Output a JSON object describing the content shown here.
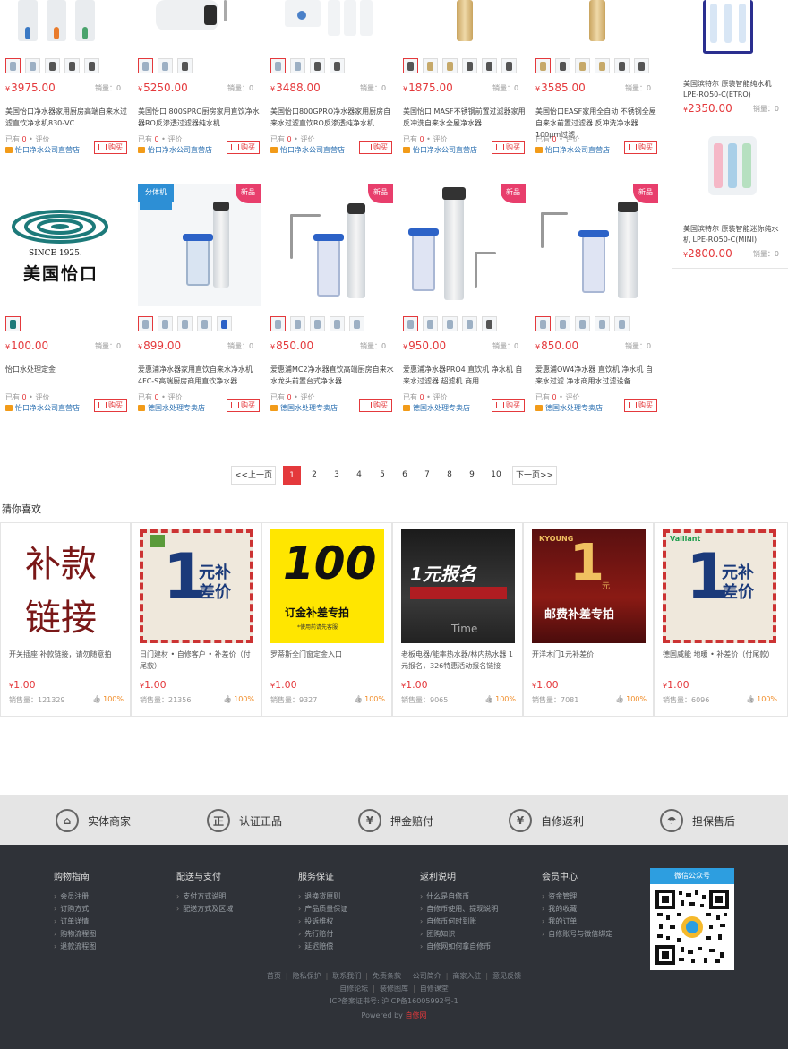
{
  "products_row1": [
    {
      "price": "3975.00",
      "sales": "销量：0",
      "name": "美国怡口净水器家用厨房高端自来水过滤直饮净水机830-VC",
      "reviews_prefix": "已有",
      "reviews_count": "0",
      "reviews_suffix": "评价",
      "shop": "怡口净水公司直营店",
      "buy": "购买"
    },
    {
      "price": "5250.00",
      "sales": "销量：0",
      "name": "美国怡口 800SPRO厨房家用直饮净水器RO反渗透过滤器纯水机",
      "reviews_prefix": "已有",
      "reviews_count": "0",
      "reviews_suffix": "评价",
      "shop": "怡口净水公司直营店",
      "buy": "购买"
    },
    {
      "price": "3488.00",
      "sales": "销量：0",
      "name": "美国怡口800GPRO净水器家用厨房自来水过滤直饮RO反渗透纯净水机",
      "reviews_prefix": "已有",
      "reviews_count": "0",
      "reviews_suffix": "评价",
      "shop": "怡口净水公司直营店",
      "buy": "购买"
    },
    {
      "price": "1875.00",
      "sales": "销量：0",
      "name": "美国怡口 MASF不锈钢前置过滤器家用反冲洗自来水全屋净水器",
      "reviews_prefix": "已有",
      "reviews_count": "0",
      "reviews_suffix": "评价",
      "shop": "怡口净水公司直营店",
      "buy": "购买"
    },
    {
      "price": "3585.00",
      "sales": "销量：0",
      "name": "美国怡口EASF家用全自动 不锈钢全屋自来水前置过滤器 反冲洗净水器 100μm过滤",
      "reviews_prefix": "已有",
      "reviews_count": "0",
      "reviews_suffix": "评价",
      "shop": "怡口净水公司直营店",
      "buy": "购买"
    }
  ],
  "products_row2": [
    {
      "price": "100.00",
      "sales": "销量：0",
      "name": "怡口水处理定金",
      "reviews_prefix": "已有",
      "reviews_count": "0",
      "reviews_suffix": "评价",
      "shop": "怡口净水公司直营店",
      "buy": "购买",
      "logo_since": "SINCE 1925.",
      "logo_name": "美国怡口"
    },
    {
      "price": "899.00",
      "sales": "销量：0",
      "name": "爱惠浦净水器家用直饮自来水净水机4FC-S高端厨房商用直饮净水器",
      "reviews_prefix": "已有",
      "reviews_count": "0",
      "reviews_suffix": "评价",
      "shop": "德国水处理专卖店",
      "buy": "购买",
      "tag": "新品",
      "banner": "分体机"
    },
    {
      "price": "850.00",
      "sales": "销量：0",
      "name": "爱惠浦MC2净水器直饮高端厨房自来水水龙头前置台式净水器",
      "reviews_prefix": "已有",
      "reviews_count": "0",
      "reviews_suffix": "评价",
      "shop": "德国水处理专卖店",
      "buy": "购买",
      "tag": "新品"
    },
    {
      "price": "950.00",
      "sales": "销量：0",
      "name": "爱惠浦净水器PRO4 直饮机 净水机 自来水过滤器 超滤机 商用",
      "reviews_prefix": "已有",
      "reviews_count": "0",
      "reviews_suffix": "评价",
      "shop": "德国水处理专卖店",
      "buy": "购买",
      "tag": "新品"
    },
    {
      "price": "850.00",
      "sales": "销量：0",
      "name": "爱惠浦OW4净水器 直饮机 净水机 自来水过滤 净水商用水过滤设备",
      "reviews_prefix": "已有",
      "reviews_count": "0",
      "reviews_suffix": "评价",
      "shop": "德国水处理专卖店",
      "buy": "购买",
      "tag": "新品"
    }
  ],
  "sidebar": [
    {
      "name": "美国滨特尔 原装智能纯水机LPE-RO50-C(ETRO)",
      "price": "2350.00",
      "sales": "销量：0"
    },
    {
      "name": "美国滨特尔 原装智能迷你纯水机 LPE-RO50-C(MINI)",
      "price": "2800.00",
      "sales": "销量：0"
    }
  ],
  "currency": "¥",
  "pagination": {
    "prev": "<<上一页",
    "pages": [
      "1",
      "2",
      "3",
      "4",
      "5",
      "6",
      "7",
      "8",
      "9",
      "10"
    ],
    "current": "1",
    "next": "下一页>>"
  },
  "guess": {
    "title": "猜你喜欢",
    "items": [
      {
        "title": "开关插座 补款链接，请勿随意拍",
        "price": "1.00",
        "sold": "销售量：121329",
        "rate": "100%",
        "img_line1": "补款",
        "img_line2": "链接"
      },
      {
        "title": "日门建材 • 自修客户 • 补差价（付尾款）",
        "price": "1.00",
        "sold": "销售量：21356",
        "rate": "100%",
        "img_big": "1",
        "img_text": "元补差价"
      },
      {
        "title": "罗蒂斯全门窗定金入口",
        "price": "1.00",
        "sold": "销售量：9327",
        "rate": "100%",
        "img_big": "100",
        "img_text": "订金补差专拍",
        "img_small": "*使用前请先客服"
      },
      {
        "title": "老板电器/能率热水器/林内热水器 1元报名，326特惠活动报名链接",
        "price": "1.00",
        "sold": "销售量：9065",
        "rate": "100%",
        "img_big": "1元报名",
        "img_text": "Time"
      },
      {
        "title": "开洋木门1元补差价",
        "price": "1.00",
        "sold": "销售量：7081",
        "rate": "100%",
        "img_brand": "KYOUNG",
        "img_big": "1",
        "img_unit": "元",
        "img_text": "邮费补差专拍"
      },
      {
        "title": "德国威能 地暖 • 补差价（付尾款）",
        "price": "1.00",
        "sold": "销售量：6096",
        "rate": "100%",
        "img_brand": "Vaillant",
        "img_big": "1",
        "img_text": "元补差价"
      }
    ]
  },
  "services": [
    {
      "icon": "shop-icon",
      "glyph": "⌂",
      "label": "实体商家"
    },
    {
      "icon": "certified-icon",
      "glyph": "正",
      "label": "认证正品"
    },
    {
      "icon": "shield-icon",
      "glyph": "¥",
      "label": "押金赔付"
    },
    {
      "icon": "rebate-icon",
      "glyph": "¥",
      "label": "自修返利"
    },
    {
      "icon": "umbrella-icon",
      "glyph": "☂",
      "label": "担保售后"
    }
  ],
  "footer": {
    "columns": [
      {
        "title": "购物指南",
        "items": [
          "会员注册",
          "订购方式",
          "订单详情",
          "购物流程图",
          "退款流程图"
        ]
      },
      {
        "title": "配送与支付",
        "items": [
          "支付方式说明",
          "配送方式及区域"
        ]
      },
      {
        "title": "服务保证",
        "items": [
          "退换货原则",
          "产品质量保证",
          "投诉维权",
          "先行赔付",
          "延迟赔偿"
        ]
      },
      {
        "title": "返利说明",
        "items": [
          "什么是自修币",
          "自修币使用、提现说明",
          "自修币何时到账",
          "团购知识",
          "自修网如何拿自修币"
        ]
      },
      {
        "title": "会员中心",
        "items": [
          "资金管理",
          "我的收藏",
          "我的订单",
          "自修账号与微信绑定"
        ]
      }
    ],
    "wechat": "微信公众号",
    "links_row1": [
      "首页",
      "隐私保护",
      "联系我们",
      "免责条款",
      "公司简介",
      "商家入驻",
      "意见反馈"
    ],
    "links_row2": [
      "自修论坛",
      "装修图库",
      "自修课堂"
    ],
    "icp": "ICP备案证书号: 沪ICP备16005992号-1",
    "powered_prefix": "Powered by",
    "powered_brand": "自修网"
  },
  "colors": {
    "accent": "#e4393c",
    "footer_bg": "#2f3238",
    "service_bar": "#e5e5e5",
    "link": "#2a6fb0"
  }
}
